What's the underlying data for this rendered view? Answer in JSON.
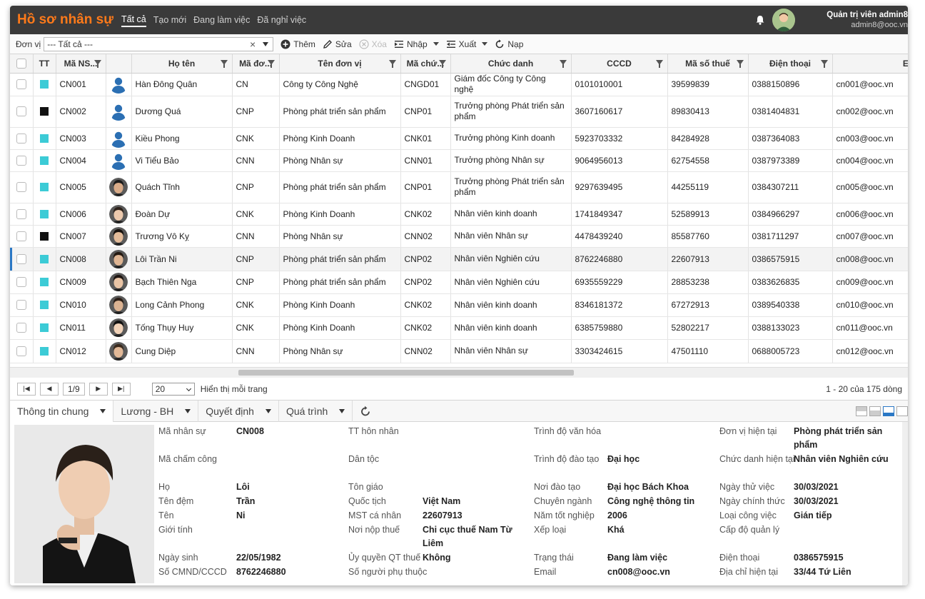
{
  "app": {
    "title": "Hồ sơ nhân sự",
    "tabs": [
      "Tất cả",
      "Tạo mới",
      "Đang làm việc",
      "Đã nghỉ việc"
    ],
    "user_name": "Quản trị viên admin8",
    "user_email": "admin8@ooc.vn"
  },
  "toolbar": {
    "unit_label": "Đơn vị",
    "unit_value": "--- Tất cả ---",
    "add": "Thêm",
    "edit": "Sửa",
    "delete": "Xóa",
    "import": "Nhập",
    "export": "Xuất",
    "reload": "Nạp"
  },
  "columns": [
    "TT",
    "Mã NS...",
    "Họ tên",
    "Mã đơ...",
    "Tên đơn vị",
    "Mã chứ...",
    "Chức danh",
    "CCCD",
    "Mã số thuế",
    "Điện thoại",
    "Em"
  ],
  "rows": [
    {
      "tt": "cyan",
      "id": "CN001",
      "photo": "default",
      "name": "Hàn Đông Quân",
      "unit_code": "CN",
      "unit": "Công ty Công Nghệ",
      "title_code": "CNGD01",
      "title": "Giám đốc Công ty Công nghệ",
      "cccd": "0101010001",
      "tax": "39599839",
      "phone": "0388150896",
      "email": "cn001@ooc.vn"
    },
    {
      "tt": "black",
      "id": "CN002",
      "photo": "default",
      "name": "Dương Quá",
      "unit_code": "CNP",
      "unit": "Phòng phát triển sản phẩm",
      "title_code": "CNP01",
      "title": "Trưởng phòng Phát triển sản phẩm",
      "cccd": "3607160617",
      "tax": "89830413",
      "phone": "0381404831",
      "email": "cn002@ooc.vn"
    },
    {
      "tt": "cyan",
      "id": "CN003",
      "photo": "default",
      "name": "Kiều Phong",
      "unit_code": "CNK",
      "unit": "Phòng Kinh Doanh",
      "title_code": "CNK01",
      "title": "Trưởng phòng Kinh doanh",
      "cccd": "5923703332",
      "tax": "84284928",
      "phone": "0387364083",
      "email": "cn003@ooc.vn"
    },
    {
      "tt": "cyan",
      "id": "CN004",
      "photo": "default",
      "name": "Vi Tiểu Bảo",
      "unit_code": "CNN",
      "unit": "Phòng Nhân sự",
      "title_code": "CNN01",
      "title": "Trưởng phòng Nhân sự",
      "cccd": "9064956013",
      "tax": "62754558",
      "phone": "0387973389",
      "email": "cn004@ooc.vn"
    },
    {
      "tt": "cyan",
      "id": "CN005",
      "photo": "real",
      "name": "Quách Tĩnh",
      "unit_code": "CNP",
      "unit": "Phòng phát triển sản phẩm",
      "title_code": "CNP01",
      "title": "Trưởng phòng Phát triển sản phẩm",
      "cccd": "9297639495",
      "tax": "44255119",
      "phone": "0384307211",
      "email": "cn005@ooc.vn"
    },
    {
      "tt": "cyan",
      "id": "CN006",
      "photo": "real",
      "name": "Đoàn Dự",
      "unit_code": "CNK",
      "unit": "Phòng Kinh Doanh",
      "title_code": "CNK02",
      "title": "Nhân viên kinh doanh",
      "cccd": "1741849347",
      "tax": "52589913",
      "phone": "0384966297",
      "email": "cn006@ooc.vn"
    },
    {
      "tt": "black",
      "id": "CN007",
      "photo": "real",
      "name": "Trương Vô Kỵ",
      "unit_code": "CNN",
      "unit": "Phòng Nhân sự",
      "title_code": "CNN02",
      "title": "Nhân viên Nhân sự",
      "cccd": "4478439240",
      "tax": "85587760",
      "phone": "0381711297",
      "email": "cn007@ooc.vn"
    },
    {
      "tt": "cyan",
      "id": "CN008",
      "photo": "real",
      "name": "Lôi Trần Ni",
      "unit_code": "CNP",
      "unit": "Phòng phát triển sản phẩm",
      "title_code": "CNP02",
      "title": "Nhân viên Nghiên cứu",
      "cccd": "8762246880",
      "tax": "22607913",
      "phone": "0386575915",
      "email": "cn008@ooc.vn",
      "selected": true
    },
    {
      "tt": "cyan",
      "id": "CN009",
      "photo": "real",
      "name": "Bạch Thiên Nga",
      "unit_code": "CNP",
      "unit": "Phòng phát triển sản phẩm",
      "title_code": "CNP02",
      "title": "Nhân viên Nghiên cứu",
      "cccd": "6935559229",
      "tax": "28853238",
      "phone": "0383626835",
      "email": "cn009@ooc.vn"
    },
    {
      "tt": "cyan",
      "id": "CN010",
      "photo": "real",
      "name": "Long Cảnh Phong",
      "unit_code": "CNK",
      "unit": "Phòng Kinh Doanh",
      "title_code": "CNK02",
      "title": "Nhân viên kinh doanh",
      "cccd": "8346181372",
      "tax": "67272913",
      "phone": "0389540338",
      "email": "cn010@ooc.vn"
    },
    {
      "tt": "cyan",
      "id": "CN011",
      "photo": "real",
      "name": "Tống Thụy Huy",
      "unit_code": "CNK",
      "unit": "Phòng Kinh Doanh",
      "title_code": "CNK02",
      "title": "Nhân viên kinh doanh",
      "cccd": "6385759880",
      "tax": "52802217",
      "phone": "0388133023",
      "email": "cn011@ooc.vn"
    },
    {
      "tt": "cyan",
      "id": "CN012",
      "photo": "real",
      "name": "Cung Diệp",
      "unit_code": "CNN",
      "unit": "Phòng Nhân sự",
      "title_code": "CNN02",
      "title": "Nhân viên Nhân sự",
      "cccd": "3303424615",
      "tax": "47501110",
      "phone": "0688005723",
      "email": "cn012@ooc.vn"
    }
  ],
  "pager": {
    "page": "1/9",
    "page_size": "20",
    "page_size_label": "Hiển thị mỗi trang",
    "total": "1 - 20 của 175 dòng"
  },
  "detail_tabs": [
    "Thông tin chung",
    "Lương - BH",
    "Quyết định",
    "Quá trình"
  ],
  "detail": {
    "col1": [
      {
        "label": "Mã nhân sự",
        "value": "CN008"
      },
      {
        "label": "Mã chấm công",
        "value": ""
      },
      {
        "label": "Họ",
        "value": "Lôi"
      },
      {
        "label": "Tên đệm",
        "value": "Trần"
      },
      {
        "label": "Tên",
        "value": "Ni"
      },
      {
        "label": "Giới tính",
        "value": ""
      },
      {
        "label": "Ngày sinh",
        "value": "22/05/1982"
      },
      {
        "label": "Số CMND/CCCD",
        "value": "8762246880"
      }
    ],
    "col2": [
      {
        "label": "TT hôn nhân",
        "value": ""
      },
      {
        "label": "Dân tộc",
        "value": ""
      },
      {
        "label": "Tôn giáo",
        "value": ""
      },
      {
        "label": "Quốc tịch",
        "value": "Việt Nam"
      },
      {
        "label": "MST cá nhân",
        "value": "22607913"
      },
      {
        "label": "Nơi nộp thuế",
        "value": "Chi cục thuế Nam Từ Liêm"
      },
      {
        "label": "Ủy quyền QT thuế",
        "value": "Không"
      },
      {
        "label": "Số người phụ thuộc",
        "value": ""
      }
    ],
    "col3": [
      {
        "label": "Trình độ văn hóa",
        "value": ""
      },
      {
        "label": "Trình độ đào tạo",
        "value": "Đại học"
      },
      {
        "label": "Nơi đào tạo",
        "value": "Đại học Bách Khoa"
      },
      {
        "label": "Chuyên ngành",
        "value": "Công nghệ thông tin"
      },
      {
        "label": "Năm tốt nghiệp",
        "value": "2006"
      },
      {
        "label": "Xếp loại",
        "value": "Khá"
      },
      {
        "label": "Trạng thái",
        "value": "Đang làm việc"
      },
      {
        "label": "Email",
        "value": "cn008@ooc.vn"
      }
    ],
    "col4": [
      {
        "label": "Đơn vị hiện tại",
        "value": "Phòng phát triển sản phẩm"
      },
      {
        "label": "Chức danh hiện tại",
        "value": "Nhân viên Nghiên cứu"
      },
      {
        "label": "Ngày thử việc",
        "value": "30/03/2021"
      },
      {
        "label": "Ngày chính thức",
        "value": "30/03/2021"
      },
      {
        "label": "Loại công việc",
        "value": "Gián tiếp"
      },
      {
        "label": "Cấp độ quản lý",
        "value": ""
      },
      {
        "label": "Điện thoại",
        "value": "0386575915"
      },
      {
        "label": "Địa chỉ hiện tại",
        "value": "33/44 Tứ Liên"
      }
    ]
  },
  "colors": {
    "cyan": "#3ccbd6",
    "black": "#111111",
    "brand": "#ff7a1a"
  }
}
